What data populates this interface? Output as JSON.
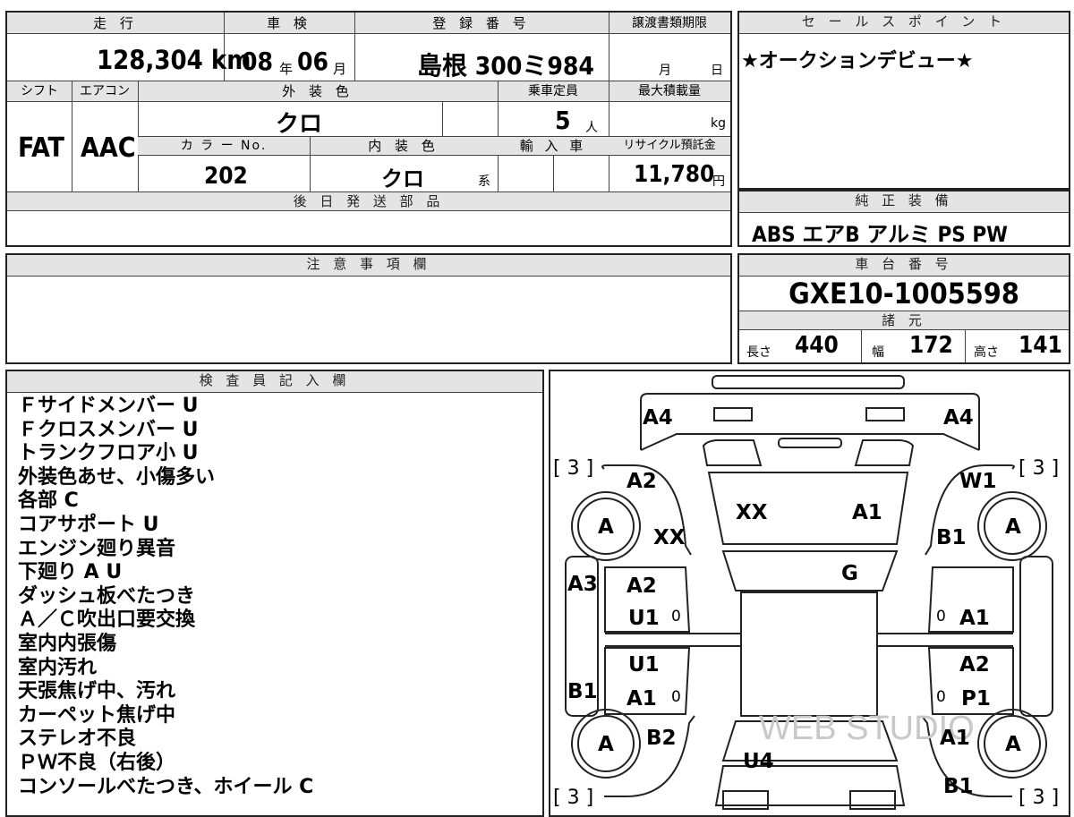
{
  "sheet": {
    "mileage_header": "走 行",
    "mileage": "128,304 km",
    "shaken_header": "車 検",
    "shaken_year": "08",
    "shaken_year_unit": "年",
    "shaken_month": "06",
    "shaken_month_unit": "月",
    "registration_header": "登 録 番 号",
    "registration": "島根 300ミ984",
    "transfer_header": "譲渡書類期限",
    "transfer_month_unit": "月",
    "transfer_day_unit": "日",
    "shift_header": "シフト",
    "shift": "FAT",
    "aircon_header": "エアコン",
    "aircon": "AAC",
    "exterior_color_header": "外 装 色",
    "exterior_color": "クロ",
    "capacity_header": "乗車定員",
    "capacity": "5",
    "capacity_unit": "人",
    "max_load_header": "最大積載量",
    "max_load_unit": "kg",
    "color_no_header": "カ ラ ー No.",
    "color_no": "202",
    "interior_color_header": "内 装 色",
    "interior_color": "クロ",
    "interior_color_suffix": "系",
    "import_header": "輸 入 車",
    "recycle_header": "リサイクル預託金",
    "recycle_amount": "11,780",
    "recycle_unit": "円",
    "later_parts_header": "後 日 発 送 部 品",
    "caution_header": "注 意 事 項 欄"
  },
  "sales_point": {
    "header": "セ ー ル ス ポ イ ン ト",
    "text": "★オークションデビュー★"
  },
  "equipment": {
    "header": "純 正 装 備",
    "text": "ABS エアB アルミ PS PW"
  },
  "chassis": {
    "header": "車 台 番 号",
    "number": "GXE10-1005598",
    "specs_header": "諸 元",
    "length_label": "長さ",
    "length": "440",
    "width_label": "幅",
    "width": "172",
    "height_label": "高さ",
    "height": "141"
  },
  "inspector": {
    "header": "検 査 員 記 入 欄",
    "notes": [
      "Ｆサイドメンバー U",
      "Ｆクロスメンバー U",
      "トランクフロア小 U",
      "外装色あせ、小傷多い",
      "各部 C",
      "コアサポート U",
      "エンジン廻り異音",
      "下廻り A U",
      "ダッシュ板べたつき",
      "Ａ／Ｃ吹出口要交換",
      "室内内張傷",
      "室内汚れ",
      "天張焦げ中、汚れ",
      "カーペット焦げ中",
      "ステレオ不良",
      "ＰＷ不良（右後）",
      "コンソールべたつき、ホイール C"
    ]
  },
  "diagram": {
    "labels": {
      "front_left": "A4",
      "front_right": "A4",
      "bracket_tl": "[ 3 ]",
      "bracket_tr": "[ 3 ]",
      "bracket_bl": "[ 3 ]",
      "bracket_br": "[ 3 ]",
      "fender_l": "A2",
      "fender_r": "W1",
      "wheel": "A",
      "xx_left": "XX",
      "hood_xx": "XX",
      "hood_a1": "A1",
      "fender_rb": "B1",
      "glass": "G",
      "pillar_l": "A3",
      "door_fl_1": "A2",
      "door_fl_2": "U1",
      "door_fr": "A1",
      "door_rl_1": "U1",
      "door_rl_2": "A1",
      "door_rr_1": "A2",
      "door_rr_2": "P1",
      "sill_l": "B1",
      "quarter_l": "B2",
      "quarter_r": "A1",
      "trunk": "U4",
      "rear_r": "B1",
      "zero": "0",
      "watermark": "WEB STUDIO"
    }
  }
}
